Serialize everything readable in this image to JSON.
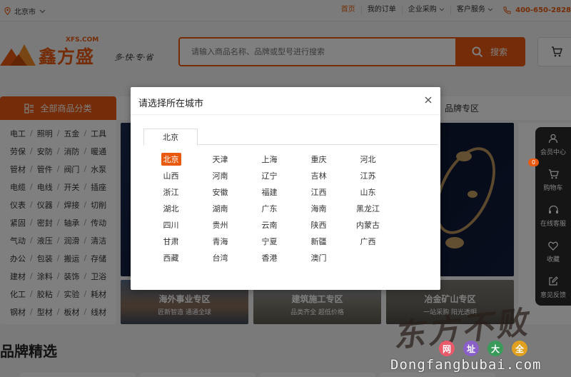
{
  "topbar": {
    "location": "北京市",
    "links": [
      "首页",
      "我的订单",
      "企业采购",
      "客户服务"
    ],
    "phone": "400-650-2828"
  },
  "header": {
    "logo_cn": "鑫方盛",
    "logo_en": "XFS.COM",
    "slogan": "多·快·专·省",
    "search_placeholder": "请输入商品名称、品牌或型号进行搜索",
    "search_button": "搜索"
  },
  "nav": {
    "category_title": "全部商品分类",
    "right_item": "品牌专区"
  },
  "categories": [
    [
      "电工",
      "照明",
      "五金",
      "工具"
    ],
    [
      "劳保",
      "安防",
      "消防",
      "暖通"
    ],
    [
      "管材",
      "管件",
      "阀门",
      "水泵"
    ],
    [
      "电缆",
      "电线",
      "开关",
      "插座"
    ],
    [
      "仪表",
      "仪器",
      "焊接",
      "切削"
    ],
    [
      "紧固",
      "密封",
      "轴承",
      "传动"
    ],
    [
      "气动",
      "液压",
      "润滑",
      "清洁"
    ],
    [
      "办公",
      "包装",
      "搬运",
      "存储"
    ],
    [
      "建材",
      "涂料",
      "装饰",
      "卫浴"
    ],
    [
      "化工",
      "胶粘",
      "实验",
      "耗材"
    ],
    [
      "钢材",
      "型材",
      "板材",
      "线材"
    ]
  ],
  "zones": [
    {
      "title": "海外事业专区",
      "subtitle": "匠新智造 通通全球"
    },
    {
      "title": "建筑施工专区",
      "subtitle": "品类齐全 超低价格"
    },
    {
      "title": "冶金矿山专区",
      "subtitle": "一站采购 阳光透明"
    }
  ],
  "sidebar": {
    "items": [
      "会员中心",
      "购物车",
      "在线客服",
      "收藏",
      "意见反馈"
    ],
    "cart_count": "0"
  },
  "section_title": "品牌精选",
  "modal": {
    "title": "请选择所在城市",
    "tab": "北京",
    "cities": [
      "北京",
      "天津",
      "上海",
      "重庆",
      "河北",
      "山西",
      "河南",
      "辽宁",
      "吉林",
      "江苏",
      "浙江",
      "安徽",
      "福建",
      "江西",
      "山东",
      "湖北",
      "湖南",
      "广东",
      "海南",
      "黑龙江",
      "四川",
      "贵州",
      "云南",
      "陕西",
      "内蒙古",
      "甘肃",
      "青海",
      "宁夏",
      "新疆",
      "广西",
      "西藏",
      "台湾",
      "香港",
      "澳门"
    ],
    "selected_index": 0
  },
  "watermark": {
    "brush": "东方不败",
    "chars": [
      "网",
      "址",
      "大",
      "全"
    ],
    "char_colors": [
      "#e95a6a",
      "#8a60c8",
      "#3a9a5a",
      "#e0a020"
    ],
    "url": "Dongfangbubai.com"
  },
  "colors": {
    "accent": "#e95a10"
  }
}
